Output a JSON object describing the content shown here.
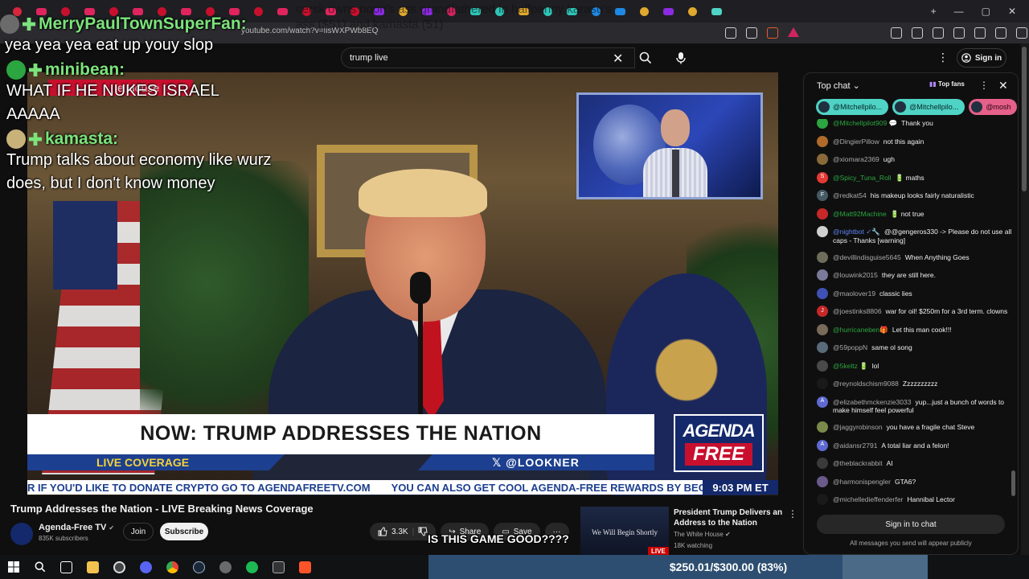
{
  "browser": {
    "url": "youtube.com/watch?v=IisWXPWb8EQ",
    "tab_colors": [
      "#d7263d",
      "#e0245e",
      "#c8102e",
      "#e0245e",
      "#c8102e",
      "#e0245e",
      "#c8102e",
      "#e0245e",
      "#c8102e",
      "#e0245e",
      "#c8102e",
      "#e0245e",
      "#c8102e",
      "#e0245e",
      "#c8102e",
      "#8a2be2",
      "#e0a82e",
      "#8a2be2",
      "#d0245e",
      "#2ec4b6",
      "#2ec4b6",
      "#e0a82e",
      "#2ec4b6",
      "#2ec4b6",
      "#1e88e5",
      "#1e88e5",
      "#e0a82e",
      "#8a2be2",
      "#e0a82e",
      "#4fd3c4"
    ]
  },
  "youtube": {
    "search_value": "trump live",
    "sign_in": "Sign in"
  },
  "overlay_chat": [
    {
      "name": "MerryPaulTownSuperFan:",
      "message": "yea yea yea eat up youy slop",
      "avatar_color": "#6b6b6b"
    },
    {
      "name": "minibean:",
      "message": "WHAT IF HE NUKES ISRAEL AAAAA",
      "avatar_color": "#2ba640"
    },
    {
      "name": "kamasta:",
      "message": "Trump talks about economy like wurz does, but I don't know money",
      "avatar_color": "#c9b27a"
    }
  ],
  "overlay_banner": "e House",
  "overlay_ghost": "cersk owns noon's ass grandfathered in halfpenny karasu's ass ($51) and kamasta (51)",
  "video": {
    "lower_third": "NOW: TRUMP ADDRESSES THE NATION",
    "live_coverage": "LIVE COVERAGE",
    "handle": "𝕏 @LOOKNER",
    "logo_line1": "AGENDA",
    "logo_line2": "FREE",
    "ticker": [
      "R IF YOU'D LIKE TO DONATE CRYPTO GO TO AGENDAFREETV.COM",
      "YOU CAN ALSO GET COOL AGENDA-FREE REWARDS BY BECOM"
    ],
    "clock": "9:03 PM ET"
  },
  "meta": {
    "title": "Trump Addresses the Nation - LIVE Breaking News Coverage",
    "channel": "Agenda-Free TV",
    "verified": "✔",
    "subscribers": "835K subscribers",
    "join": "Join",
    "subscribe": "Subscribe",
    "likes": "3.3K",
    "share": "Share",
    "save": "Save",
    "more": "···"
  },
  "game_overlay": "IS THIS GAME GOOD????",
  "recommendation": {
    "title": "President Trump Delivers an Address to the Nation",
    "channel": "The White House",
    "watching": "18K watching",
    "thumb_text": "We Will Begin Shortly",
    "live": "LIVE"
  },
  "chat": {
    "header": "Top chat",
    "top_fans": "Top fans",
    "pinned": [
      {
        "name": "@Mitchellpilo...",
        "color": "teal"
      },
      {
        "name": "@Mitchellpilo...",
        "color": "teal"
      },
      {
        "name": "@mosh",
        "color": "pink"
      }
    ],
    "messages": [
      {
        "author": "@Mitchellpilot909 💬",
        "text": "Thank you",
        "style": "green",
        "avatar": "#2ba640",
        "letter": ""
      },
      {
        "author": "@DingierPillow",
        "text": "not this again",
        "style": "",
        "avatar": "#b06a2a",
        "letter": ""
      },
      {
        "author": "@xiomara2369",
        "text": "ugh",
        "style": "",
        "avatar": "#8a6a3a",
        "letter": ""
      },
      {
        "author": "@Spicy_Tuna_Roll",
        "text": "🔋 maths",
        "style": "green",
        "avatar": "#e53935",
        "letter": "S"
      },
      {
        "author": "@redkat54",
        "text": "his makeup looks fairly naturalistic",
        "style": "",
        "avatar": "#455a64",
        "letter": "F"
      },
      {
        "author": "@Matt92Machine",
        "text": "🔋 not true",
        "style": "green",
        "avatar": "#c62828",
        "letter": ""
      },
      {
        "author": "@nightbot ✓🔧",
        "text": "@@gengeros330 -> Please do not use all caps - Thanks [warning]",
        "style": "mod",
        "avatar": "#cfcfcf",
        "letter": ""
      },
      {
        "author": "@devillindisguise5645",
        "text": "When Anything Goes",
        "style": "",
        "avatar": "#6d6d5a",
        "letter": ""
      },
      {
        "author": "@louwink2015",
        "text": "they are still here.",
        "style": "",
        "avatar": "#7a7a9a",
        "letter": ""
      },
      {
        "author": "@maolover19",
        "text": "classic lies",
        "style": "",
        "avatar": "#3f51b5",
        "letter": ""
      },
      {
        "author": "@joestinks8806",
        "text": "war for oil! $250m for a 3rd term. clowns",
        "style": "",
        "avatar": "#c62828",
        "letter": "J"
      },
      {
        "author": "@hurricaneben🎁",
        "text": "Let this man cook!!!",
        "style": "green",
        "avatar": "#7a6a5a",
        "letter": ""
      },
      {
        "author": "@59poppN",
        "text": "same ol song",
        "style": "",
        "avatar": "#5a6a7a",
        "letter": ""
      },
      {
        "author": "@5keltz 🔋",
        "text": "lol",
        "style": "green",
        "avatar": "#4a4a4a",
        "letter": ""
      },
      {
        "author": "@reynoldschism9088",
        "text": "Zzzzzzzzzz",
        "style": "",
        "avatar": "#1a1a1a",
        "letter": ""
      },
      {
        "author": "@elizabethmckenzie3033",
        "text": "yup...just a bunch of words to make himself feel powerful",
        "style": "",
        "avatar": "#5e6ad2",
        "letter": "A"
      },
      {
        "author": "@jaggyrobinson",
        "text": "you have a fragile chat Steve",
        "style": "",
        "avatar": "#7a8a4a",
        "letter": ""
      },
      {
        "author": "@aidansr2791",
        "text": "A total liar and a felon!",
        "style": "",
        "avatar": "#5e6ad2",
        "letter": "A"
      },
      {
        "author": "@theblackrabbit",
        "text": "AI",
        "style": "",
        "avatar": "#3a3a3a",
        "letter": ""
      },
      {
        "author": "@harmonispengler",
        "text": "GTA6?",
        "style": "",
        "avatar": "#6a5a8a",
        "letter": ""
      },
      {
        "author": "@michelledieffenderfer",
        "text": "Hannibal Lector",
        "style": "",
        "avatar": "#1a1a1a",
        "letter": ""
      },
      {
        "author": "@Gh9st",
        "text": "true",
        "style": "",
        "avatar": "#d81b60",
        "letter": ""
      }
    ],
    "signin": "Sign in to chat",
    "note": "All messages you send will appear publicly"
  },
  "donation": {
    "label": "$250.01/$300.00 (83%)",
    "progress": 0.83
  }
}
